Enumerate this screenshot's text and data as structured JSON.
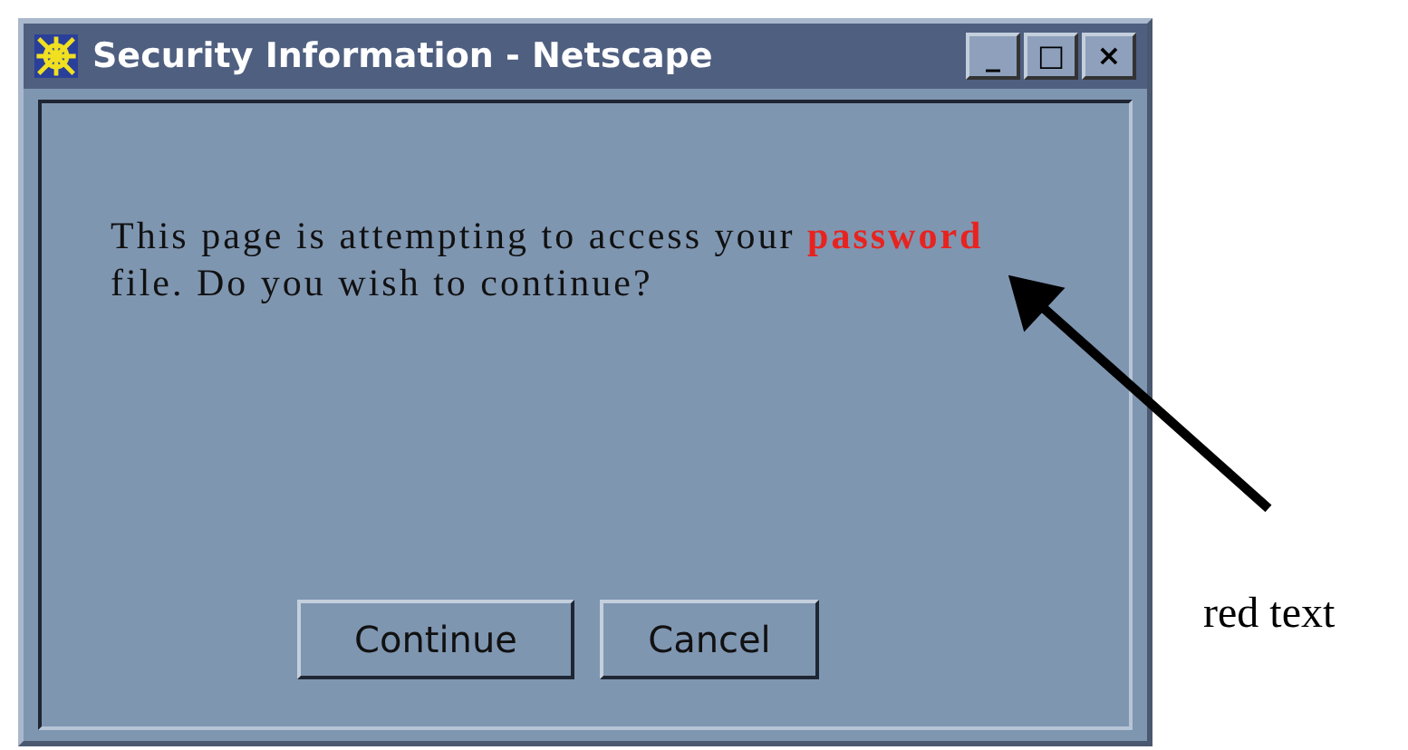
{
  "window": {
    "title": "Security Information - Netscape",
    "controls": [
      "_",
      "□",
      "×"
    ]
  },
  "message": {
    "text_before": "This page is attempting to access your",
    "highlight": {
      "text": "password",
      "color": "#e8231f"
    },
    "text_after": "file. Do you wish to continue?"
  },
  "buttons": [
    "Continue",
    "Cancel"
  ],
  "annotation": {
    "label": "red text"
  }
}
